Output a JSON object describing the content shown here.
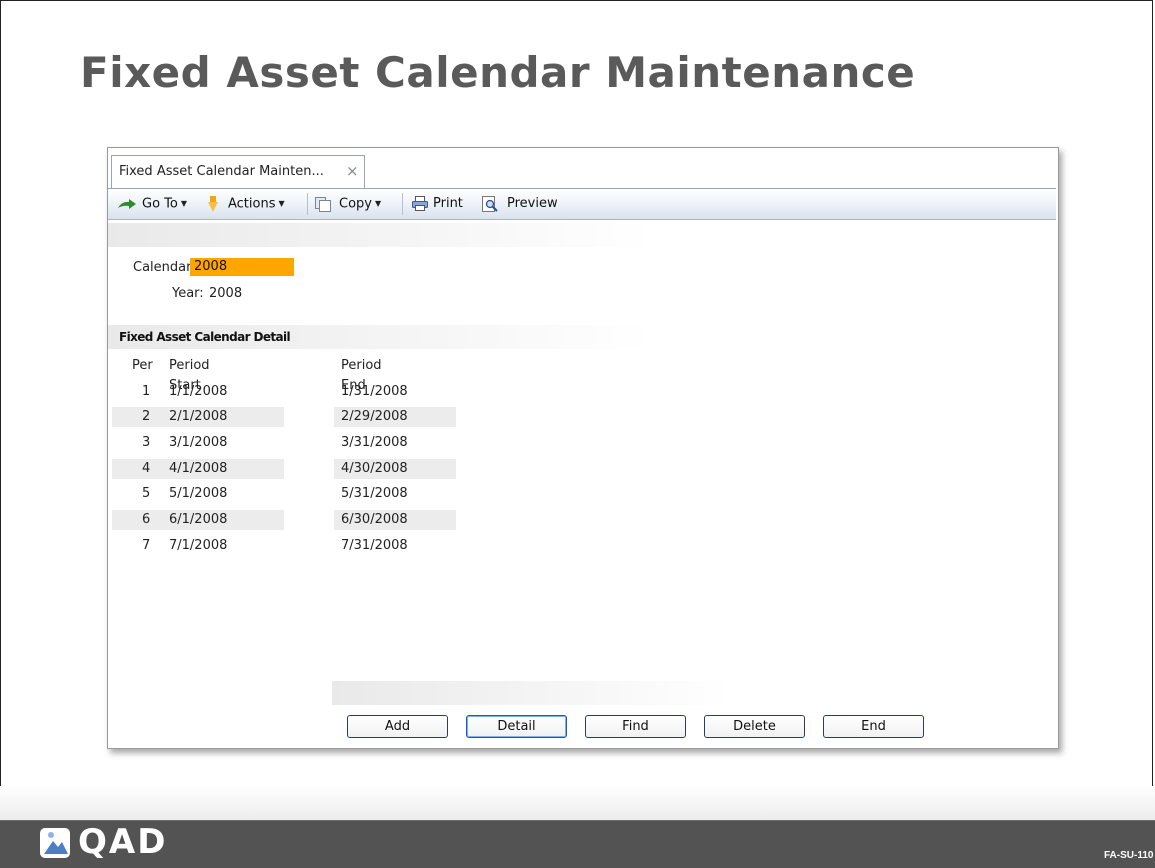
{
  "slide": {
    "title": "Fixed Asset Calendar Maintenance",
    "code": "FA-SU-110",
    "brand": "QAD"
  },
  "window": {
    "tab_label": "Fixed Asset Calendar Mainten...",
    "tab_close": "×"
  },
  "toolbar": {
    "goto_label": "Go To",
    "actions_label": "Actions",
    "copy_label": "Copy",
    "print_label": "Print",
    "preview_label": "Preview",
    "caret": "▼",
    "icons": [
      "goto-arrow-icon",
      "actions-pin-icon",
      "copy-icon",
      "printer-icon",
      "preview-icon"
    ]
  },
  "form": {
    "calendar_label": "Calendar:",
    "calendar_value": "2008",
    "year_label": "Year:",
    "year_value": "2008",
    "calendar_highlight_color": "#ffa500"
  },
  "detail": {
    "section_title": "Fixed Asset Calendar Detail",
    "columns": [
      "Per",
      "Period Start",
      "Period End"
    ],
    "rows": [
      {
        "per": "1",
        "start": "1/1/2008",
        "end": "1/31/2008"
      },
      {
        "per": "2",
        "start": "2/1/2008",
        "end": "2/29/2008"
      },
      {
        "per": "3",
        "start": "3/1/2008",
        "end": "3/31/2008"
      },
      {
        "per": "4",
        "start": "4/1/2008",
        "end": "4/30/2008"
      },
      {
        "per": "5",
        "start": "5/1/2008",
        "end": "5/31/2008"
      },
      {
        "per": "6",
        "start": "6/1/2008",
        "end": "6/30/2008"
      },
      {
        "per": "7",
        "start": "7/1/2008",
        "end": "7/31/2008"
      }
    ]
  },
  "buttons": {
    "add": "Add",
    "detail": "Detail",
    "find": "Find",
    "delete": "Delete",
    "end": "End"
  }
}
